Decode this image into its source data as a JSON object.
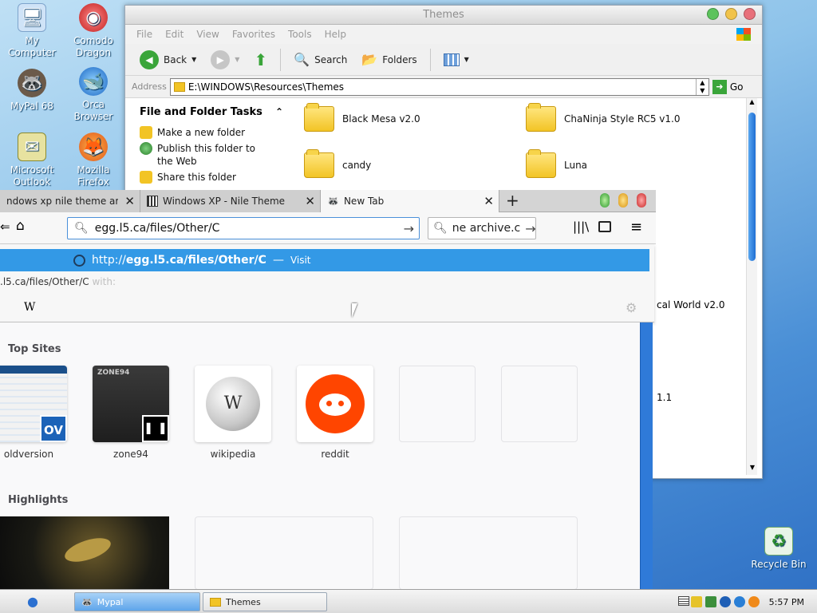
{
  "desktop": {
    "icons": [
      {
        "label": "My\nComputer",
        "icon": "computer-icon"
      },
      {
        "label": "Comodo\nDragon",
        "icon": "comodo-dragon-icon"
      },
      {
        "label": "MyPal 68",
        "icon": "mypal-icon"
      },
      {
        "label": "Orca\nBrowser",
        "icon": "orca-icon"
      },
      {
        "label": "Microsoft\nOutlook",
        "icon": "outlook-icon"
      },
      {
        "label": "Mozilla\nFirefox",
        "icon": "firefox-icon"
      },
      {
        "label": "Recycle Bin",
        "icon": "recycle-bin-icon"
      }
    ]
  },
  "explorer": {
    "title": "Themes",
    "menu": [
      "File",
      "Edit",
      "View",
      "Favorites",
      "Tools",
      "Help"
    ],
    "toolbar": {
      "back": "Back",
      "search": "Search",
      "folders": "Folders"
    },
    "address_label": "Address",
    "address": "E:\\WINDOWS\\Resources\\Themes",
    "go": "Go",
    "tasks_title": "File and Folder Tasks",
    "tasks": [
      "Make a new folder",
      "Publish this folder to the Web",
      "Share this folder"
    ],
    "folders": [
      "Black Mesa v2.0",
      "ChaNinja Style RC5 v1.0",
      "candy",
      "Luna"
    ],
    "partial_texts": [
      "cal World v2.0",
      "1.1"
    ]
  },
  "browser": {
    "tabs": [
      {
        "label": "ndows xp nile theme archi"
      },
      {
        "label": "Windows XP - Nile Theme"
      },
      {
        "label": "New Tab"
      }
    ],
    "url_value": "egg.l5.ca/files/Other/C",
    "search_value": "ne archive.c",
    "suggestion": {
      "prefix": "http://",
      "bold": "egg.l5.ca/files/Other/C",
      "dash": "—",
      "action": "Visit"
    },
    "search_with": ".l5.ca/files/Other/C",
    "search_with_suffix": "with:",
    "engine_glyph": "W",
    "top_sites_title": "Top Sites",
    "top_sites": [
      {
        "label": "oldversion",
        "badge": "OV"
      },
      {
        "label": "zone94",
        "badge": ""
      },
      {
        "label": "wikipedia",
        "badge": ""
      },
      {
        "label": "reddit",
        "badge": ""
      }
    ],
    "highlights_title": "Highlights"
  },
  "taskbar": {
    "buttons": [
      {
        "label": "Mypal"
      },
      {
        "label": "Themes"
      }
    ],
    "clock": "5:57 PM"
  },
  "colors": {
    "accent": "#3399e6",
    "scroll_blue": "#2f7ad8",
    "reddit": "#ff4500"
  }
}
